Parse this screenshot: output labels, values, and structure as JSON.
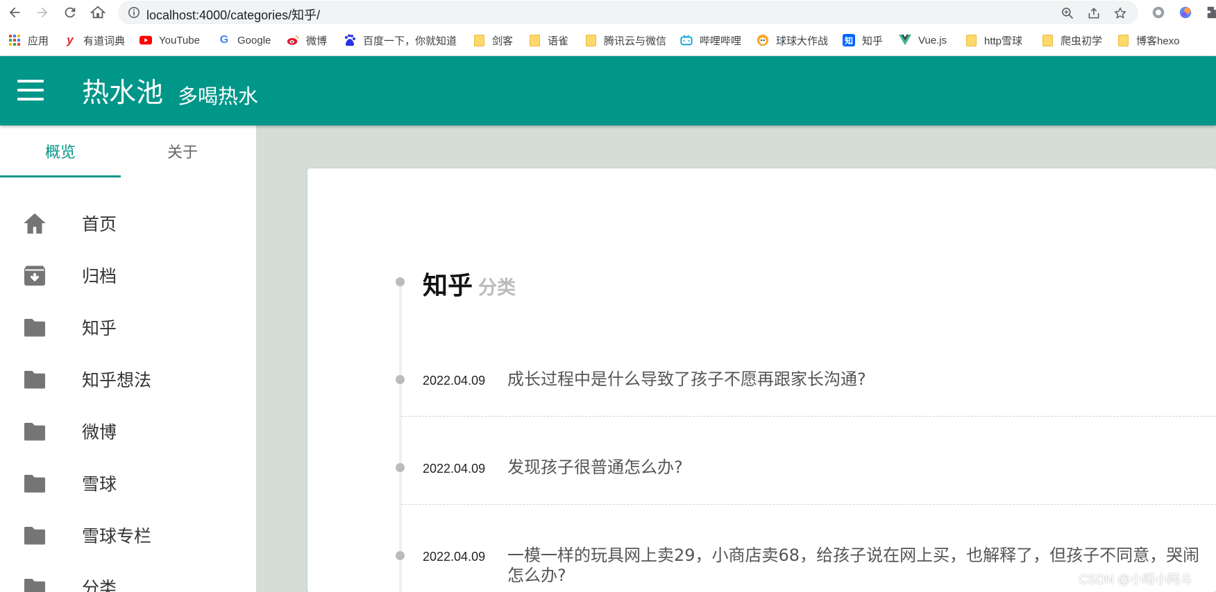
{
  "browser": {
    "url": "localhost:4000/categories/知乎/"
  },
  "bookmarks": [
    {
      "label": "应用",
      "icon": "apps-grid-icon"
    },
    {
      "label": "有道词典",
      "icon": "youdao-icon",
      "glyph": "y",
      "color": "#e3262e"
    },
    {
      "label": "YouTube",
      "icon": "youtube-icon",
      "color": "#ff0000"
    },
    {
      "label": "Google",
      "icon": "google-icon",
      "glyph": "G",
      "color": "#4285f4"
    },
    {
      "label": "微博",
      "icon": "weibo-icon",
      "color": "#e6162d"
    },
    {
      "label": "百度一下，你就知道",
      "icon": "baidu-icon",
      "color": "#2932e1"
    },
    {
      "label": "剑客",
      "icon": "folder-icon"
    },
    {
      "label": "语雀",
      "icon": "folder-icon"
    },
    {
      "label": "腾讯云与微信",
      "icon": "folder-icon"
    },
    {
      "label": "哔哩哔哩",
      "icon": "bilibili-icon",
      "color": "#00a1d6"
    },
    {
      "label": "球球大作战",
      "icon": "game-icon",
      "color": "#f5a623"
    },
    {
      "label": "知乎",
      "icon": "zhihu-icon",
      "glyph": "知",
      "color": "#0066ff"
    },
    {
      "label": "Vue.js",
      "icon": "vue-icon",
      "color": "#41b883"
    },
    {
      "label": "http雪球",
      "icon": "folder-icon"
    },
    {
      "label": "爬虫初学",
      "icon": "folder-icon"
    },
    {
      "label": "博客hexo",
      "icon": "folder-icon"
    }
  ],
  "header": {
    "title": "热水池",
    "subtitle": "多喝热水",
    "color": "#009688"
  },
  "sidebar": {
    "tabs": [
      {
        "label": "概览",
        "active": true
      },
      {
        "label": "关于",
        "active": false
      }
    ],
    "items": [
      {
        "label": "首页",
        "icon": "home-icon"
      },
      {
        "label": "归档",
        "icon": "archive-icon"
      },
      {
        "label": "知乎",
        "icon": "folder-icon"
      },
      {
        "label": "知乎想法",
        "icon": "folder-icon"
      },
      {
        "label": "微博",
        "icon": "folder-icon"
      },
      {
        "label": "雪球",
        "icon": "folder-icon"
      },
      {
        "label": "雪球专栏",
        "icon": "folder-icon"
      },
      {
        "label": "分类",
        "icon": "folder-icon"
      }
    ]
  },
  "category": {
    "name": "知乎",
    "suffix": "分类"
  },
  "posts": [
    {
      "date": "2022.04.09",
      "title": "成长过程中是什么导致了孩子不愿再跟家长沟通?"
    },
    {
      "date": "2022.04.09",
      "title": "发现孩子很普通怎么办?"
    },
    {
      "date": "2022.04.09",
      "title": "一模一样的玩具网上卖29，小商店卖68，给孩子说在网上买，也解释了，但孩子不同意，哭闹怎么办?"
    }
  ],
  "watermark": "CSDN @小呀小阿斗"
}
